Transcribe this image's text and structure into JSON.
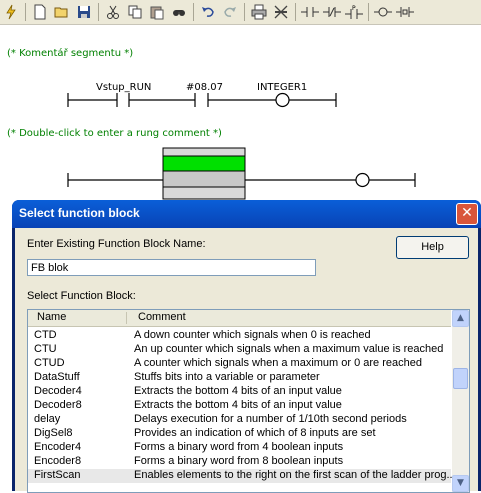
{
  "toolbar": {
    "icons": [
      "lightning-icon",
      "new-file-icon",
      "open-folder-icon",
      "save-icon",
      "cut-icon",
      "copy-icon",
      "paste-icon",
      "find-icon",
      "undo-icon",
      "redo-icon",
      "print-icon",
      "cross-tool-icon",
      "contact-no-icon",
      "contact-nc-icon",
      "contact-p-icon",
      "coil-icon",
      "coil-set-icon"
    ]
  },
  "ladder": {
    "segment_comment": "(* Komentář segmentu *)",
    "rung1": {
      "label1": "Vstup_RUN",
      "label2": "#08.07",
      "label3": "INTEGER1"
    },
    "rung_comment": "(* Double-click to enter a rung comment *)"
  },
  "dialog": {
    "title": "Select function block",
    "close": "✕",
    "name_label": "Enter Existing Function Block Name:",
    "name_value": "FB blok",
    "help_label": "Help",
    "select_label": "Select Function Block:",
    "columns": {
      "name": "Name",
      "comment": "Comment"
    },
    "rows": [
      {
        "name": "CTD",
        "comment": "A down counter which signals when 0 is reached"
      },
      {
        "name": "CTU",
        "comment": "An up counter which signals when a maximum value is reached"
      },
      {
        "name": "CTUD",
        "comment": "A counter which signals when a maximum or 0 are reached"
      },
      {
        "name": "DataStuff",
        "comment": "Stuffs bits into a variable or parameter"
      },
      {
        "name": "Decoder4",
        "comment": "Extracts the bottom 4 bits of an input value"
      },
      {
        "name": "Decoder8",
        "comment": "Extracts the bottom 4 bits of an input value"
      },
      {
        "name": "delay",
        "comment": "Delays execution for a number of 1/10th second periods"
      },
      {
        "name": "DigSel8",
        "comment": "Provides an indication of which of 8 inputs are set"
      },
      {
        "name": "Encoder4",
        "comment": "Forms a binary word from 4 boolean inputs"
      },
      {
        "name": "Encoder8",
        "comment": "Forms a binary word from 8 boolean inputs"
      },
      {
        "name": "FirstScan",
        "comment": "Enables elements to the right on the first scan of the ladder prog..."
      }
    ]
  }
}
